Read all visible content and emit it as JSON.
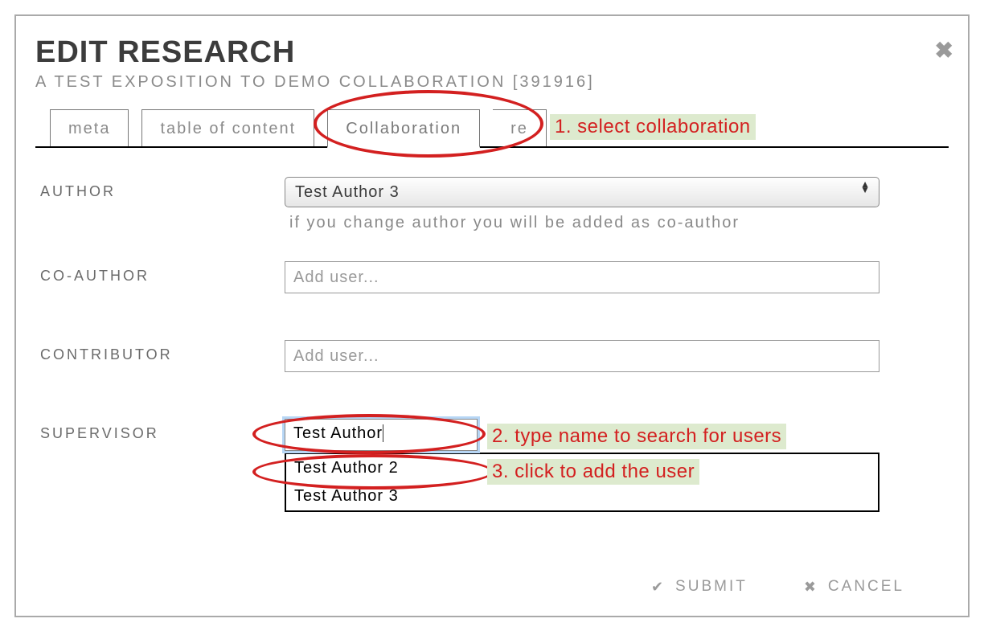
{
  "dialog": {
    "title": "EDIT RESEARCH",
    "subtitle": "A TEST EXPOSITION TO DEMO COLLABORATION [391916]"
  },
  "tabs": {
    "meta": "meta",
    "toc": "table of content",
    "collaboration": "Collaboration",
    "re": "re"
  },
  "fields": {
    "author": {
      "label": "AUTHOR",
      "value": "Test Author 3",
      "help": "if you change author you will be added as co-author"
    },
    "coauthor": {
      "label": "CO-AUTHOR",
      "placeholder": "Add user..."
    },
    "contributor": {
      "label": "CONTRIBUTOR",
      "placeholder": "Add user..."
    },
    "supervisor": {
      "label": "SUPERVISOR",
      "value": "Test Author",
      "options": [
        "Test Author 2",
        "Test Author 3"
      ]
    }
  },
  "annotations": {
    "a1": "1. select collaboration",
    "a2": "2. type name to search for users",
    "a3": "3. click to add the user"
  },
  "buttons": {
    "submit": "SUBMIT",
    "cancel": "CANCEL"
  }
}
